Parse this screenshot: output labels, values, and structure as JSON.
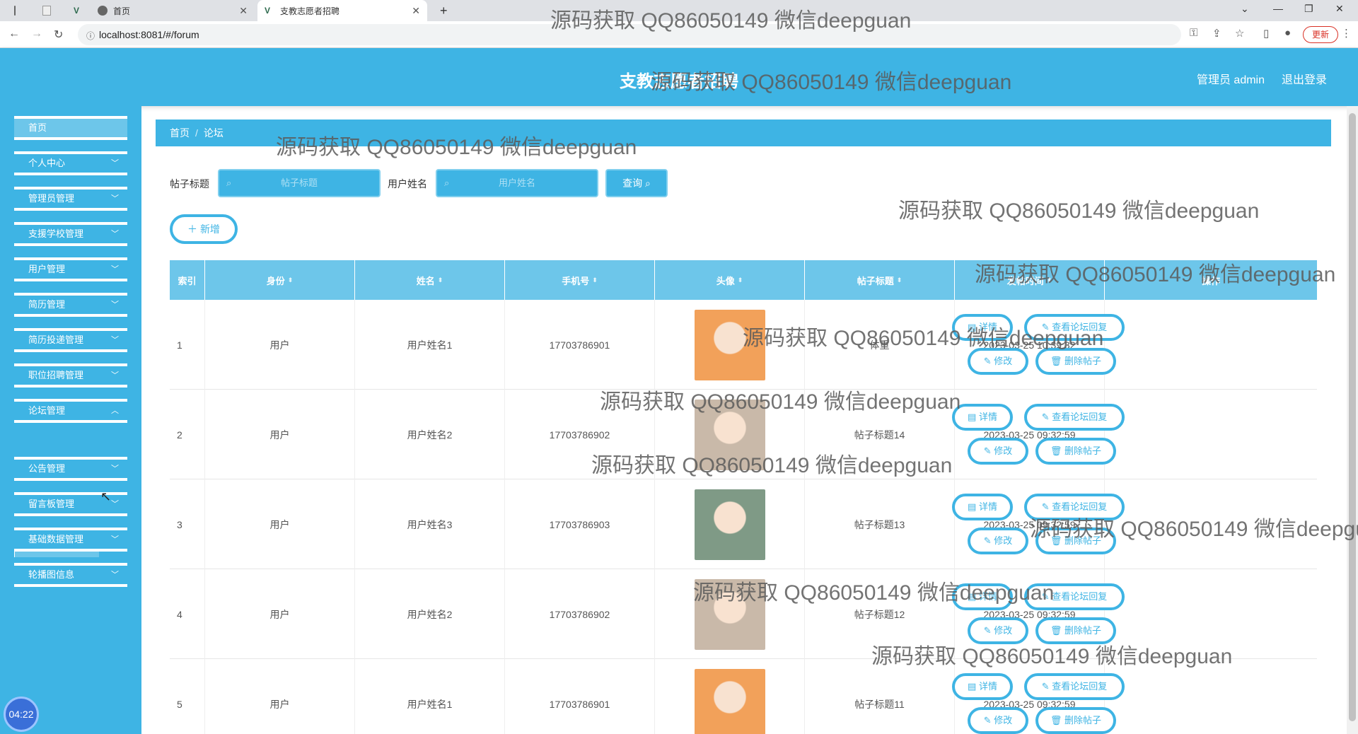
{
  "browser": {
    "tabs": [
      {
        "label": ""
      },
      {
        "label": ""
      },
      {
        "label": "首页"
      },
      {
        "label": "支教志愿者招聘"
      }
    ],
    "url": "localhost:8081/#/forum",
    "update_label": "更新"
  },
  "app": {
    "title": "支教志愿者招聘",
    "user_label": "管理员 admin",
    "logout_label": "退出登录"
  },
  "sidebar": {
    "items": [
      {
        "label": "首页"
      },
      {
        "label": "个人中心"
      },
      {
        "label": "管理员管理"
      },
      {
        "label": "支援学校管理"
      },
      {
        "label": "用户管理"
      },
      {
        "label": "简历管理"
      },
      {
        "label": "简历投递管理"
      },
      {
        "label": "职位招聘管理"
      },
      {
        "label": "论坛管理"
      },
      {
        "label": "公告管理"
      },
      {
        "label": "留言板管理"
      },
      {
        "label": "基础数据管理"
      },
      {
        "label": "轮播图信息"
      }
    ],
    "submenu": {
      "label": "论坛管理"
    },
    "clock": "04:22"
  },
  "breadcrumb": {
    "home": "首页",
    "current": "论坛"
  },
  "search": {
    "title_label": "帖子标题",
    "title_placeholder": "帖子标题",
    "name_label": "用户姓名",
    "name_placeholder": "用户姓名",
    "query_label": "查询"
  },
  "add_label": "新增",
  "table": {
    "headers": [
      "索引",
      "身份",
      "姓名",
      "手机号",
      "头像",
      "帖子标题",
      "发帖时间",
      "操作"
    ],
    "rows": [
      {
        "index": "1",
        "role": "用户",
        "name": "用户姓名1",
        "phone": "17703786901",
        "title": "体重",
        "time": "2023-03-25 10:39:32",
        "avatar_color": "#f2a15a"
      },
      {
        "index": "2",
        "role": "用户",
        "name": "用户姓名2",
        "phone": "17703786902",
        "title": "帖子标题14",
        "time": "2023-03-25 09:32:59",
        "avatar_color": "#c9b9a9"
      },
      {
        "index": "3",
        "role": "用户",
        "name": "用户姓名3",
        "phone": "17703786903",
        "title": "帖子标题13",
        "time": "2023-03-25 09:32:59",
        "avatar_color": "#7f9a86"
      },
      {
        "index": "4",
        "role": "用户",
        "name": "用户姓名2",
        "phone": "17703786902",
        "title": "帖子标题12",
        "time": "2023-03-25 09:32:59",
        "avatar_color": "#c9b9a9"
      },
      {
        "index": "5",
        "role": "用户",
        "name": "用户姓名1",
        "phone": "17703786901",
        "title": "帖子标题11",
        "time": "2023-03-25 09:32:59",
        "avatar_color": "#f2a15a"
      }
    ],
    "actions": {
      "detail": "详情",
      "view_reply": "查看论坛回复",
      "edit": "修改",
      "delete": "删除帖子"
    }
  },
  "watermark_text": "源码获取 QQ86050149 微信deepguan",
  "colors": {
    "primary": "#3eb4e4",
    "header_row": "#6dc6ea"
  }
}
